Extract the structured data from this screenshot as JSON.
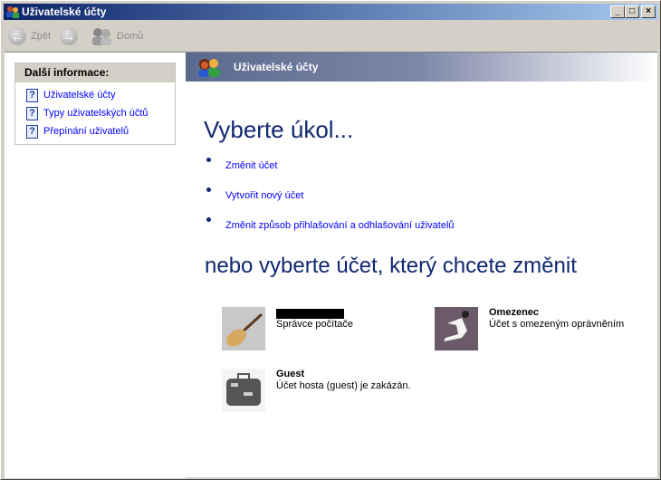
{
  "window": {
    "title": "Uživatelské účty",
    "minimize": "_",
    "maximize": "□",
    "close": "×"
  },
  "toolbar": {
    "back": "Zpět",
    "forward": "",
    "home": "Domů"
  },
  "sidebar": {
    "heading": "Další informace:",
    "links": [
      {
        "label": "Uživatelské účty"
      },
      {
        "label": "Typy uživatelských účtů"
      },
      {
        "label": "Přepínání uživatelů"
      }
    ]
  },
  "banner": {
    "title": "Uživatelské účty"
  },
  "main": {
    "pick_task": "Vyberte úkol...",
    "tasks": [
      {
        "label": "Změnit účet"
      },
      {
        "label": "Vytvořit nový účet"
      },
      {
        "label": "Změnit způsob přihlašování a odhlašování uživatelů"
      }
    ],
    "pick_account": "nebo vyberte účet, který chcete změnit",
    "accounts": [
      {
        "name": "",
        "desc": "Správce počítače"
      },
      {
        "name": "Omezenec",
        "desc": "Účet s omezeným oprávněním"
      },
      {
        "name": "Guest",
        "desc": "Účet hosta (guest) je zakázán."
      }
    ]
  }
}
